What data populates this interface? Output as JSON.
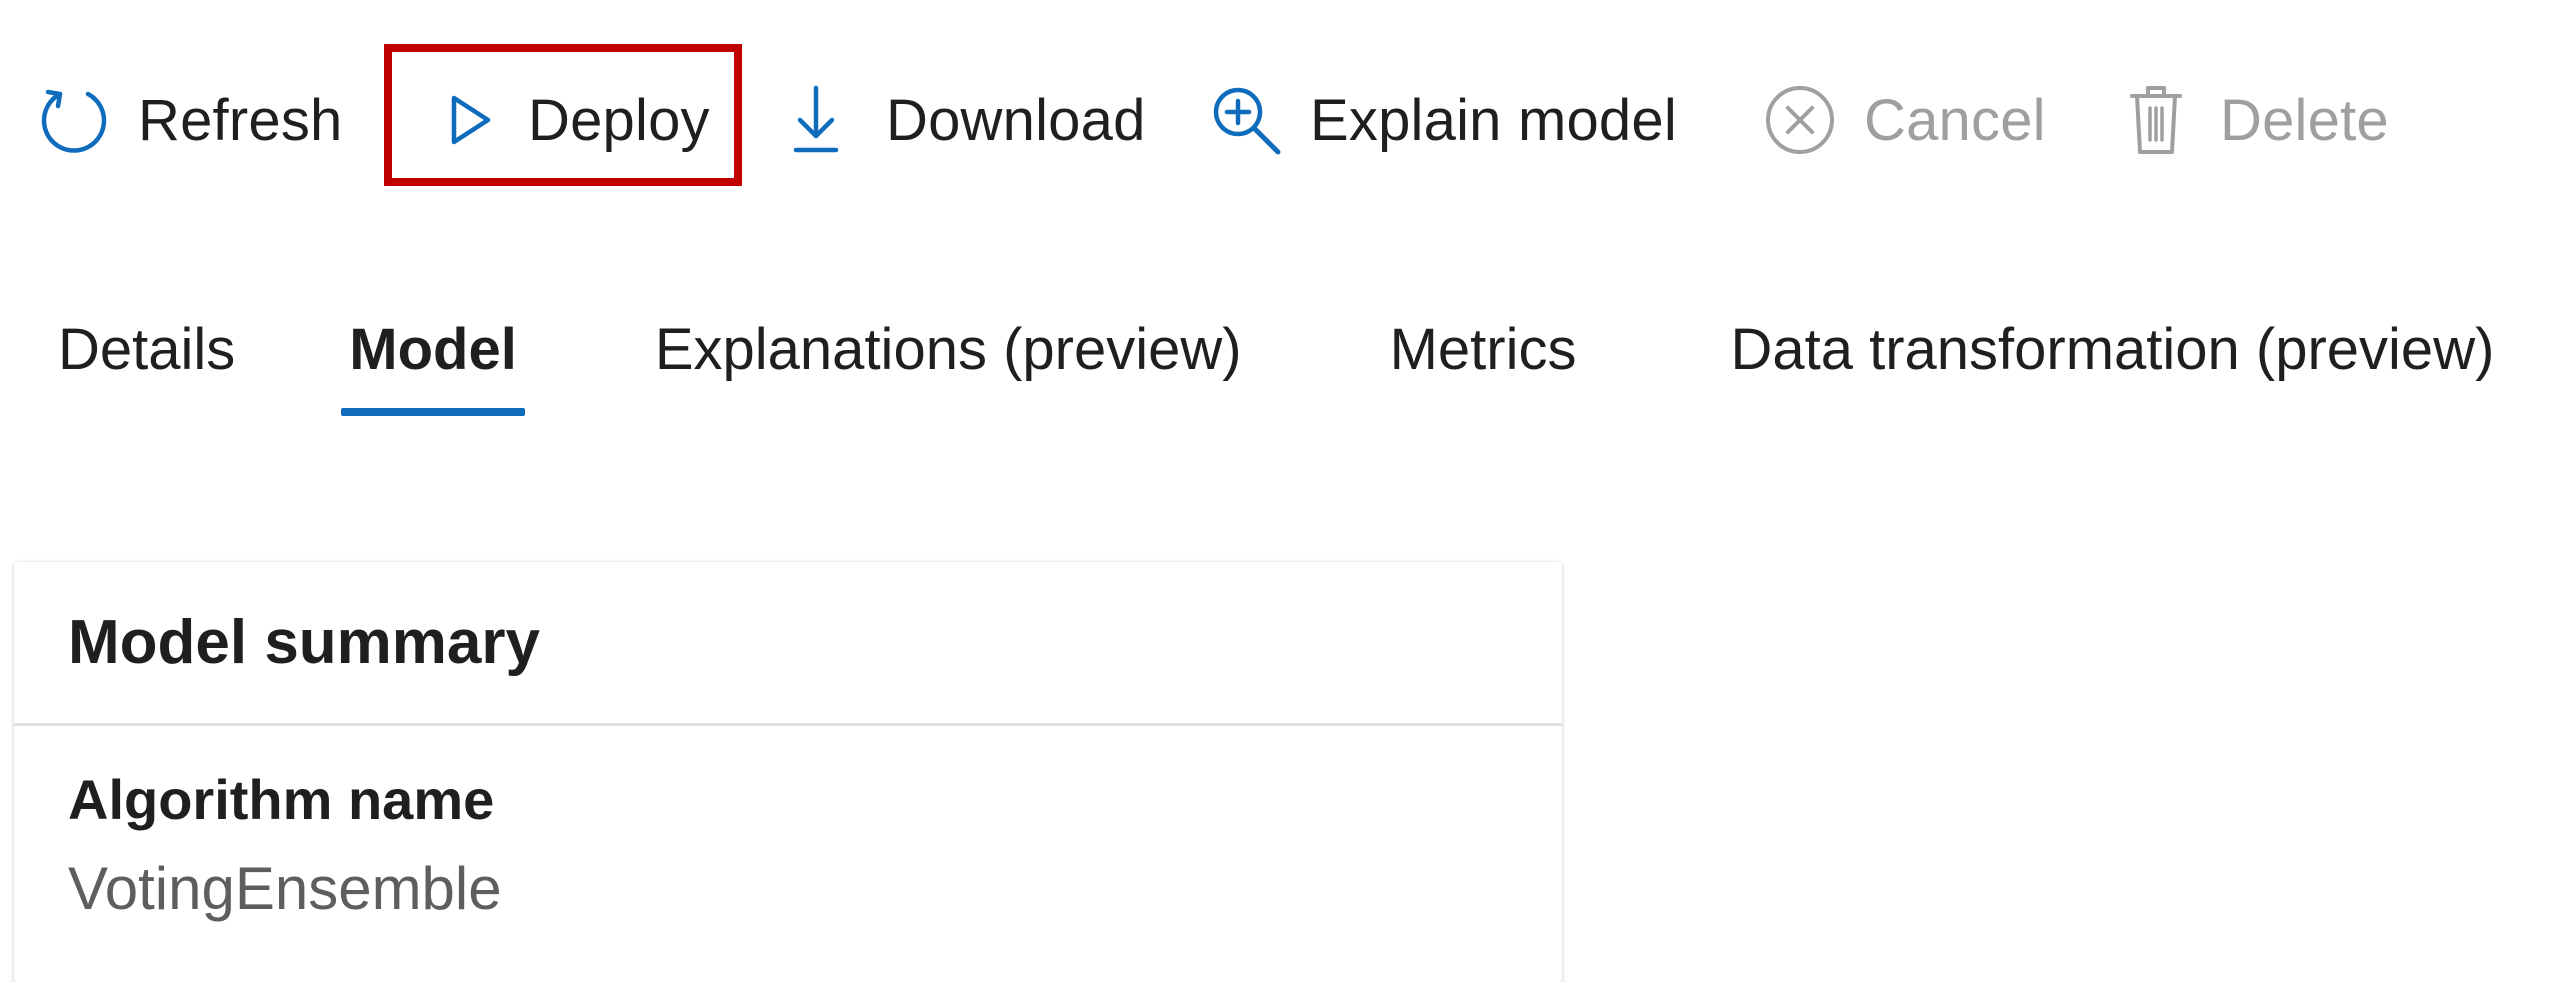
{
  "toolbar": {
    "refresh": {
      "label": "Refresh",
      "icon": "refresh-icon"
    },
    "deploy": {
      "label": "Deploy",
      "icon": "play-icon"
    },
    "download": {
      "label": "Download",
      "icon": "download-icon"
    },
    "explain": {
      "label": "Explain model",
      "icon": "zoom-in-icon"
    },
    "cancel": {
      "label": "Cancel",
      "icon": "cancel-icon",
      "disabled": true
    },
    "delete": {
      "label": "Delete",
      "icon": "trash-icon",
      "disabled": true
    }
  },
  "tabs": [
    {
      "label": "Details",
      "active": false
    },
    {
      "label": "Model",
      "active": true
    },
    {
      "label": "Explanations (preview)",
      "active": false
    },
    {
      "label": "Metrics",
      "active": false
    },
    {
      "label": "Data transformation (preview)",
      "active": false
    }
  ],
  "model_summary": {
    "title": "Model summary",
    "algorithm_label": "Algorithm name",
    "algorithm_value": "VotingEnsemble"
  },
  "colors": {
    "accent": "#0f6cbd",
    "highlight": "#c00000",
    "disabled": "#a19f9d",
    "text": "#201f1e",
    "secondary_text": "#605e5c"
  }
}
